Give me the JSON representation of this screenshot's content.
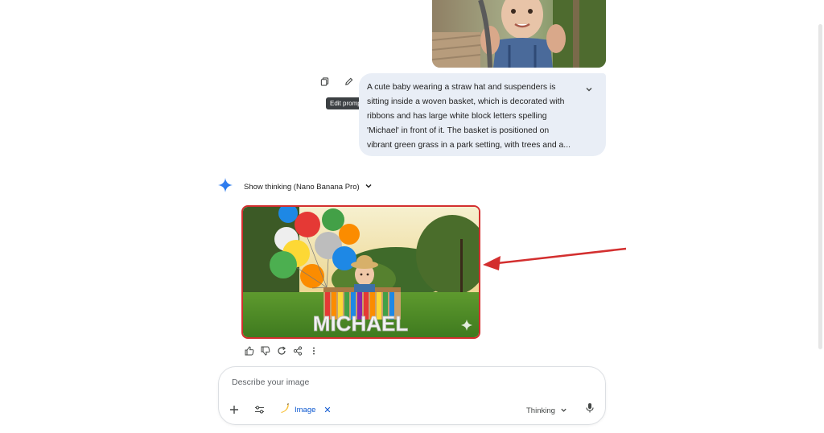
{
  "prompt": {
    "text": "A cute baby wearing a straw hat and suspenders is sitting inside a woven basket, which is decorated with ribbons and has large white block letters spelling 'Michael' in front of it. The basket is positioned on vibrant green grass in a park setting, with trees and a...",
    "copy_icon": "copy-icon",
    "edit_icon": "pencil-icon",
    "tooltip": "Edit prompt",
    "expand_icon": "chevron-down-icon"
  },
  "response": {
    "thinking_label": "Show thinking (Nano Banana Pro)",
    "image_letters": "MICHAEL"
  },
  "composer": {
    "placeholder": "Describe your image",
    "chip_label": "Image",
    "mode_label": "Thinking"
  },
  "colors": {
    "highlight": "#d32f2f",
    "accent": "#0b57d0",
    "bubble": "#e9eef6"
  }
}
